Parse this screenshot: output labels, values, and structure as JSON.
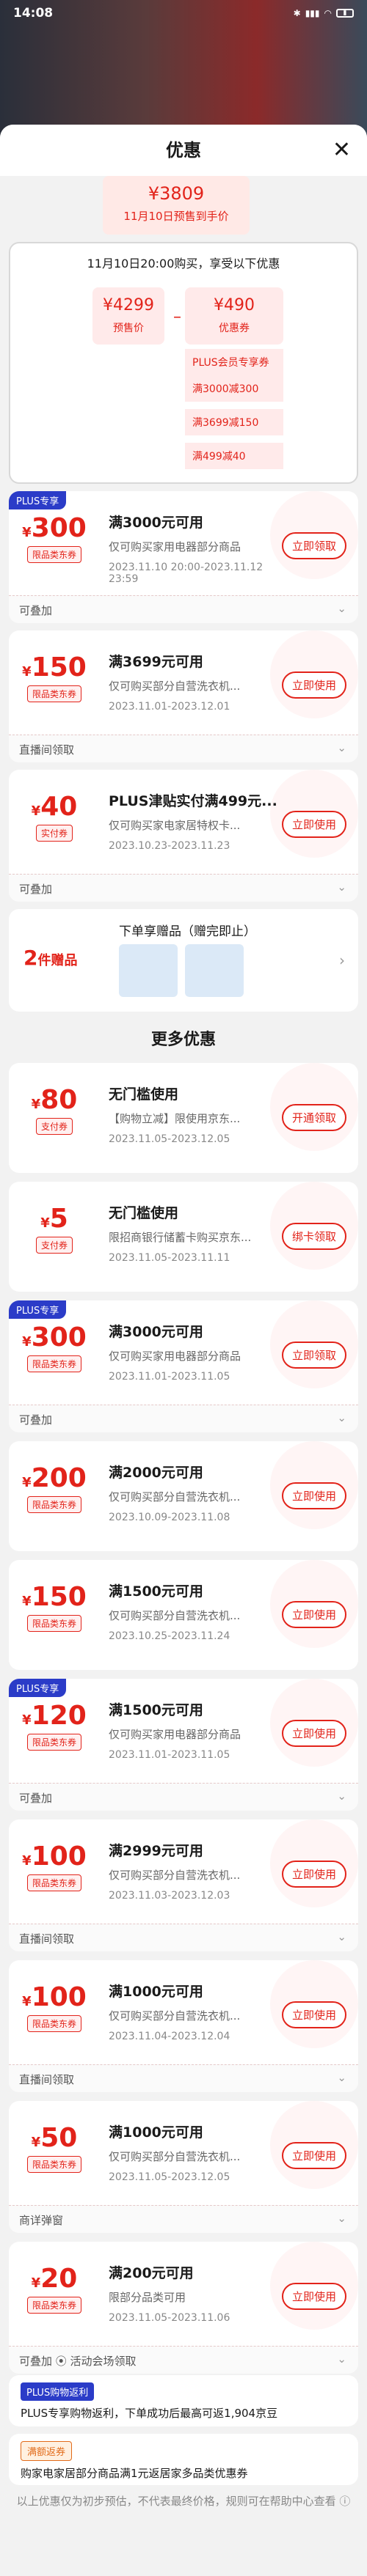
{
  "status": {
    "time": "14:08"
  },
  "header": {
    "title": "优惠",
    "close": "✕"
  },
  "price": {
    "amount": "¥3809",
    "label": "11月10日预售到手价"
  },
  "calc": {
    "title": "11月10日20:00购买，享受以下优惠",
    "pre_value": "¥4299",
    "pre_label": "预售价",
    "minus": "–",
    "coupon_value": "¥490",
    "coupon_label": "优惠券",
    "items": [
      "PLUS会员专享券",
      "满3000减300",
      "满3699减150",
      "满499减40"
    ]
  },
  "cards": [
    {
      "badge": "PLUS专享",
      "amount": "300",
      "tag": "限品类东券",
      "title": "满3000元可用",
      "desc": "仅可购买家用电器部分商品",
      "date": "2023.11.10 20:00-2023.11.12 23:59",
      "btn": "立即领取",
      "foot": "可叠加"
    },
    {
      "badge": "",
      "amount": "150",
      "tag": "限品类东券",
      "title": "满3699元可用",
      "desc": "仅可购买部分自营洗衣机...",
      "date": "2023.11.01-2023.12.01",
      "btn": "立即使用",
      "foot": "直播间领取"
    },
    {
      "badge": "",
      "amount": "40",
      "tag": "实付券",
      "title": "PLUS津贴实付满499元...",
      "desc": "仅可购买家电家居特权卡...",
      "date": "2023.10.23-2023.11.23",
      "btn": "立即使用",
      "foot": "可叠加"
    }
  ],
  "gift": {
    "count": "2",
    "unit": "件赠品",
    "title": "下单享赠品（赠完即止）"
  },
  "more_title": "更多优惠",
  "more": [
    {
      "badge": "",
      "amount": "80",
      "tag": "支付券",
      "title": "无门槛使用",
      "desc": "【购物立减】限使用京东...",
      "date": "2023.11.05-2023.12.05",
      "btn": "开通领取",
      "foot": ""
    },
    {
      "badge": "",
      "amount": "5",
      "tag": "支付券",
      "title": "无门槛使用",
      "desc": "限招商银行储蓄卡购买京东...",
      "date": "2023.11.05-2023.11.11",
      "btn": "绑卡领取",
      "foot": ""
    },
    {
      "badge": "PLUS专享",
      "amount": "300",
      "tag": "限品类东券",
      "title": "满3000元可用",
      "desc": "仅可购买家用电器部分商品",
      "date": "2023.11.01-2023.11.05",
      "btn": "立即领取",
      "foot": "可叠加"
    },
    {
      "badge": "",
      "amount": "200",
      "tag": "限品类东券",
      "title": "满2000元可用",
      "desc": "仅可购买部分自营洗衣机...",
      "date": "2023.10.09-2023.11.08",
      "btn": "立即使用",
      "foot": ""
    },
    {
      "badge": "",
      "amount": "150",
      "tag": "限品类东券",
      "title": "满1500元可用",
      "desc": "仅可购买部分自营洗衣机...",
      "date": "2023.10.25-2023.11.24",
      "btn": "立即使用",
      "foot": ""
    },
    {
      "badge": "PLUS专享",
      "amount": "120",
      "tag": "限品类东券",
      "title": "满1500元可用",
      "desc": "仅可购买家用电器部分商品",
      "date": "2023.11.01-2023.11.05",
      "btn": "立即使用",
      "foot": "可叠加"
    },
    {
      "badge": "",
      "amount": "100",
      "tag": "限品类东券",
      "title": "满2999元可用",
      "desc": "仅可购买部分自营洗衣机...",
      "date": "2023.11.03-2023.12.03",
      "btn": "立即使用",
      "foot": "直播间领取"
    },
    {
      "badge": "",
      "amount": "100",
      "tag": "限品类东券",
      "title": "满1000元可用",
      "desc": "仅可购买部分自营洗衣机...",
      "date": "2023.11.04-2023.12.04",
      "btn": "立即使用",
      "foot": "直播间领取"
    },
    {
      "badge": "",
      "amount": "50",
      "tag": "限品类东券",
      "title": "满1000元可用",
      "desc": "仅可购买部分自营洗衣机...",
      "date": "2023.11.05-2023.12.05",
      "btn": "立即使用",
      "foot": "商详弹窗"
    },
    {
      "badge": "",
      "amount": "20",
      "tag": "限品类东券",
      "title": "满200元可用",
      "desc": "限部分品类可用",
      "date": "2023.11.05-2023.11.06",
      "btn": "立即使用",
      "foot": "可叠加  ⦿ 活动会场领取"
    }
  ],
  "notes": {
    "plus_badge": "PLUS购物返利",
    "plus_text": "PLUS专享购物返利，下单成功后最高可返1,904京豆",
    "other_badge": "满额返券",
    "other_text": "购家电家居部分商品满1元返居家多品类优惠券"
  },
  "disclaimer": "以上优惠仅为初步预估，不代表最终价格，规则可在帮助中心查看 ⓘ"
}
